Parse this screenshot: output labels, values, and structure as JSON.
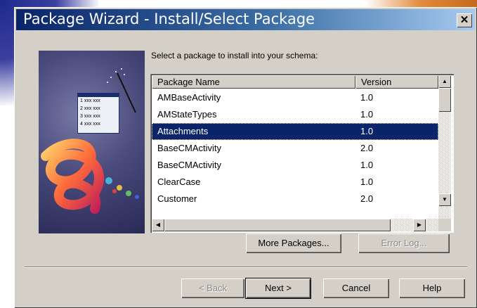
{
  "window": {
    "title": "Package Wizard - Install/Select Package",
    "close_glyph": "✕"
  },
  "instruction": "Select a package to install into your schema:",
  "table": {
    "columns": [
      "Package Name",
      "Version"
    ],
    "rows": [
      {
        "name": "AMBaseActivity",
        "version": "1.0",
        "selected": false
      },
      {
        "name": "AMStateTypes",
        "version": "1.0",
        "selected": false
      },
      {
        "name": "Attachments",
        "version": "1.0",
        "selected": true
      },
      {
        "name": "BaseCMActivity",
        "version": "2.0",
        "selected": false
      },
      {
        "name": "BaseCMActivity",
        "version": "1.0",
        "selected": false
      },
      {
        "name": "ClearCase",
        "version": "1.0",
        "selected": false
      },
      {
        "name": "Customer",
        "version": "2.0",
        "selected": false
      }
    ]
  },
  "buttons": {
    "more_packages": "More Packages...",
    "error_log": "Error Log...",
    "back": "< Back",
    "next": "Next >",
    "cancel": "Cancel",
    "help": "Help"
  },
  "artwork_list": [
    "1 xxx xxx",
    "2 xxx xxx",
    "3 xxx xxx",
    "4 xxx xxx"
  ],
  "colors": {
    "titlebar_start": "#0a246a",
    "titlebar_end": "#a6caf0",
    "selection": "#0a246a",
    "face": "#d4d0c8"
  }
}
